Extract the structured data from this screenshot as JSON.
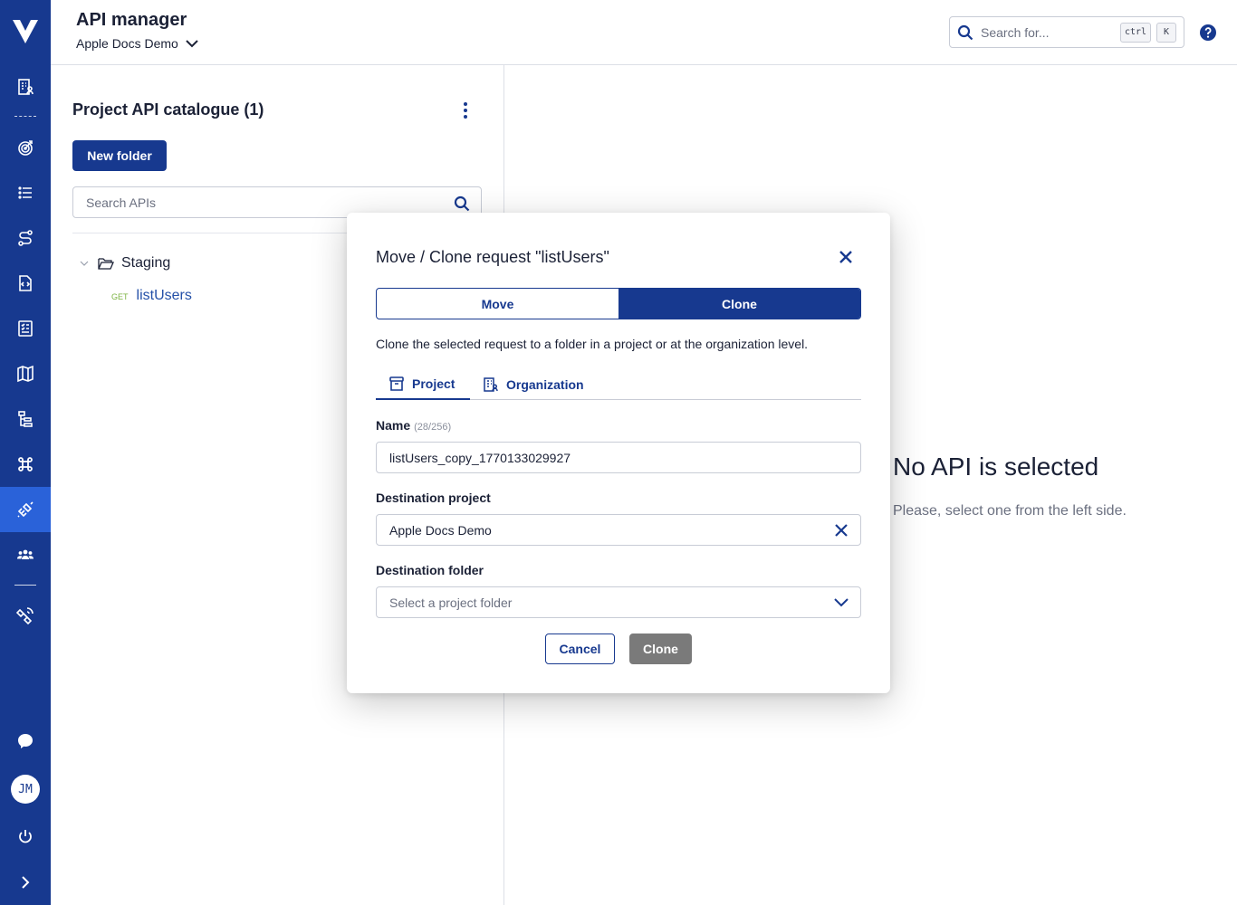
{
  "header": {
    "title": "API manager",
    "project_name": "Apple Docs Demo",
    "search_placeholder": "Search for...",
    "shortcut_keys": [
      "ctrl",
      "K"
    ]
  },
  "sidebar": {
    "items": [
      {
        "icon": "org-building-icon"
      },
      {
        "icon": "target-icon"
      },
      {
        "icon": "list-icon"
      },
      {
        "icon": "route-icon"
      },
      {
        "icon": "code-file-icon"
      },
      {
        "icon": "checklist-icon"
      },
      {
        "icon": "map-icon"
      },
      {
        "icon": "hierarchy-icon"
      },
      {
        "icon": "command-icon"
      },
      {
        "icon": "api-plug-icon",
        "active": true
      },
      {
        "icon": "team-icon"
      },
      {
        "icon": "satellite-icon"
      }
    ],
    "user_initials": "JM",
    "bottom_icons": [
      "chat-icon",
      "power-icon",
      "expand-icon"
    ]
  },
  "catalogue": {
    "title": "Project API catalogue (1)",
    "new_folder_label": "New folder",
    "search_placeholder": "Search APIs",
    "folders": [
      {
        "name": "Staging",
        "requests": [
          {
            "method": "GET",
            "name": "listUsers"
          }
        ]
      }
    ]
  },
  "empty_state": {
    "title": "No API is selected",
    "subtitle": "Please, select one from the left side."
  },
  "modal": {
    "title": "Move / Clone request \"listUsers\"",
    "mode_tabs": [
      {
        "label": "Move",
        "active": false
      },
      {
        "label": "Clone",
        "active": true
      }
    ],
    "description": "Clone the selected request to a folder in a project or at the organization level.",
    "scope_tabs": [
      {
        "label": "Project",
        "icon": "archive-box-icon",
        "active": true
      },
      {
        "label": "Organization",
        "icon": "org-building-icon",
        "active": false
      }
    ],
    "name_label": "Name",
    "name_counter": "(28/256)",
    "name_value": "listUsers_copy_1770133029927",
    "destination_project_label": "Destination project",
    "destination_project_value": "Apple Docs Demo",
    "destination_folder_label": "Destination folder",
    "destination_folder_placeholder": "Select a project folder",
    "cancel_label": "Cancel",
    "clone_label": "Clone"
  },
  "colors": {
    "primary": "#17398f",
    "active_nav": "#2a62d9",
    "get_method": "#7cb342",
    "disabled_button": "#7a7a7a"
  }
}
